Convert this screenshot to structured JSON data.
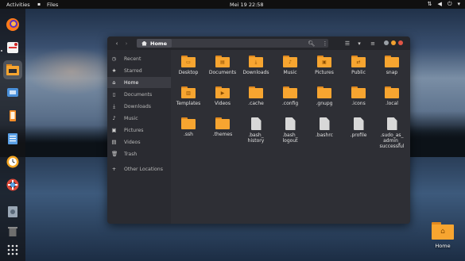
{
  "topbar": {
    "activities": "Activities",
    "app_name": "Files",
    "clock": "Mei 19  22:58"
  },
  "window": {
    "path": "Home"
  },
  "sidebar": {
    "items": [
      {
        "label": "Recent",
        "icon": "clock-icon"
      },
      {
        "label": "Starred",
        "icon": "star-icon"
      },
      {
        "label": "Home",
        "icon": "home-icon"
      },
      {
        "label": "Documents",
        "icon": "document-icon"
      },
      {
        "label": "Downloads",
        "icon": "download-icon"
      },
      {
        "label": "Music",
        "icon": "music-icon"
      },
      {
        "label": "Pictures",
        "icon": "picture-icon"
      },
      {
        "label": "Videos",
        "icon": "video-icon"
      },
      {
        "label": "Trash",
        "icon": "trash-icon"
      },
      {
        "label": "Other Locations",
        "icon": "plus-icon"
      }
    ]
  },
  "files": [
    {
      "name": "Desktop",
      "kind": "folder"
    },
    {
      "name": "Documents",
      "kind": "folder"
    },
    {
      "name": "Downloads",
      "kind": "folder"
    },
    {
      "name": "Music",
      "kind": "folder"
    },
    {
      "name": "Pictures",
      "kind": "folder"
    },
    {
      "name": "Public",
      "kind": "folder"
    },
    {
      "name": "snap",
      "kind": "folder"
    },
    {
      "name": "Templates",
      "kind": "folder"
    },
    {
      "name": "Videos",
      "kind": "folder"
    },
    {
      "name": ".cache",
      "kind": "folder"
    },
    {
      "name": ".config",
      "kind": "folder"
    },
    {
      "name": ".gnupg",
      "kind": "folder"
    },
    {
      "name": ".icons",
      "kind": "folder"
    },
    {
      "name": ".local",
      "kind": "folder"
    },
    {
      "name": ".ssh",
      "kind": "folder"
    },
    {
      "name": ".themes",
      "kind": "folder"
    },
    {
      "name": ".bash_\nhistory",
      "kind": "file"
    },
    {
      "name": ".bash_\nlogout",
      "kind": "file"
    },
    {
      "name": ".bashrc",
      "kind": "file"
    },
    {
      "name": ".profile",
      "kind": "file"
    },
    {
      "name": ".sudo_as_\nadmin_\nsuccessful",
      "kind": "file"
    }
  ],
  "desktop": {
    "home_label": "Home"
  },
  "colors": {
    "folder": "#f7a530",
    "folder_dark": "#e0891f",
    "window_bg": "#2e2f35",
    "sidebar_bg": "#2a2b31",
    "close": "#e05545",
    "minimize": "#f0a030",
    "maximize": "#9aa0a6"
  }
}
